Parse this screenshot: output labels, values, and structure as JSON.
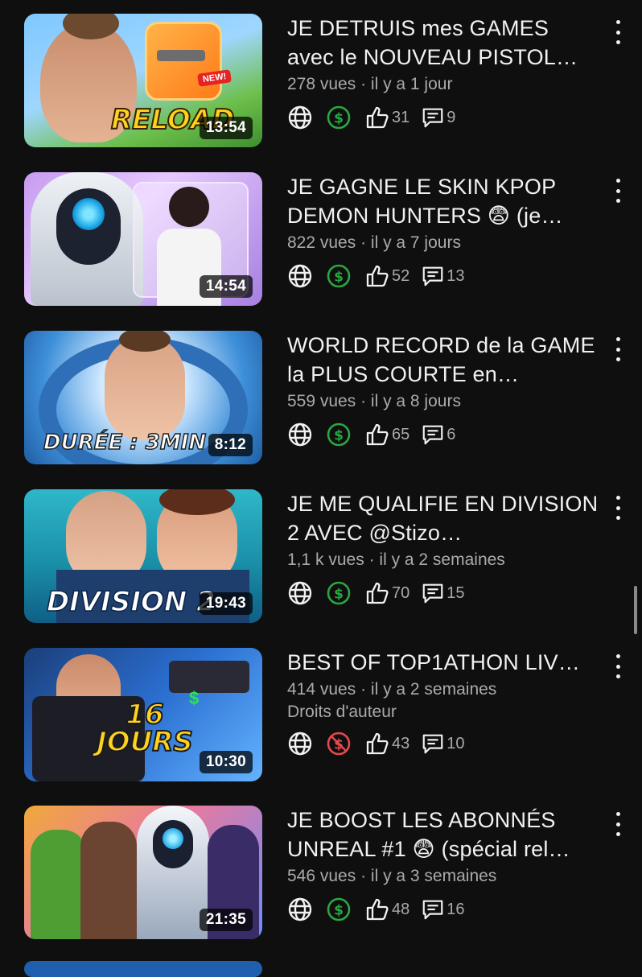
{
  "videos": [
    {
      "title": "JE DETRUIS mes GAMES avec le NOUVEAU PISTOL…",
      "views": "278 vues",
      "age": "il y a 1 jour",
      "duration": "13:54",
      "monetization": "monetized",
      "likes": "31",
      "comments": "9",
      "thumb_text": "RELOAD",
      "thumb_badge": "NEW!"
    },
    {
      "title": "JE GAGNE LE SKIN KPOP DEMON HUNTERS 😨 (je…",
      "views": "822 vues",
      "age": "il y a 7 jours",
      "duration": "14:54",
      "monetization": "monetized",
      "likes": "52",
      "comments": "13"
    },
    {
      "title": "WORLD RECORD de la GAME la PLUS COURTE en…",
      "views": "559 vues",
      "age": "il y a 8 jours",
      "duration": "8:12",
      "monetization": "monetized",
      "likes": "65",
      "comments": "6",
      "thumb_text": "DURÉE : 3MIN"
    },
    {
      "title": "JE ME QUALIFIE EN DIVISION 2 AVEC @Stizo…",
      "views": "1,1 k vues",
      "age": "il y a 2 semaines",
      "duration": "19:43",
      "monetization": "monetized",
      "likes": "70",
      "comments": "15",
      "thumb_text": "DIVISION 2"
    },
    {
      "title": "BEST OF TOP1ATHON LIV…",
      "views": "414 vues",
      "age": "il y a 2 semaines",
      "rights": "Droits d'auteur",
      "duration": "10:30",
      "monetization": "not-monetized",
      "likes": "43",
      "comments": "10",
      "thumb_text": "16 JOURS"
    },
    {
      "title": "JE BOOST LES ABONNÉS UNREAL #1 😨 (spécial rel…",
      "views": "546 vues",
      "age": "il y a 3 semaines",
      "duration": "21:35",
      "monetization": "monetized",
      "likes": "48",
      "comments": "16"
    }
  ],
  "icons": {
    "visibility": "globe-icon",
    "monetized": "dollar-circle-icon",
    "not_monetized": "dollar-off-icon",
    "likes": "thumbs-up-icon",
    "comments": "comment-icon",
    "menu": "more-vertical-icon"
  },
  "colors": {
    "background": "#0f0f0f",
    "text": "#f1f1f1",
    "secondary_text": "#aaaaaa",
    "monetized_green": "#2ba640",
    "not_monetized_red": "#e5484d"
  }
}
